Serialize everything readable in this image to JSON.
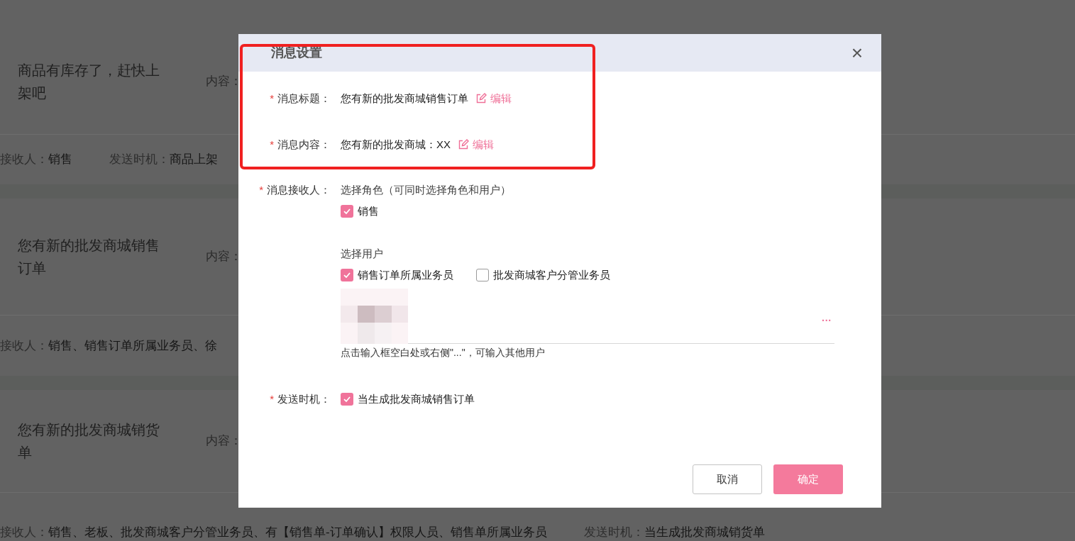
{
  "background": {
    "rows": [
      {
        "title": "商品有库存了，赶快上架吧",
        "content_label": "内容：",
        "receiver_label": "接收人：",
        "receiver_value": "销售",
        "timing_label": "发送时机：",
        "timing_value": "商品上架"
      },
      {
        "title": "您有新的批发商城销售订单",
        "content_label": "内容：",
        "receiver_label": "接收人：",
        "receiver_value": "销售、销售订单所属业务员、徐"
      },
      {
        "title": "您有新的批发商城销货单",
        "content_label": "内容：",
        "receiver_label": "接收人：",
        "receiver_value": "销售、老板、批发商城客户分管业务员、有【销售单-订单确认】权限人员、销售单所属业务员",
        "timing_label": "发送时机：",
        "timing_value": "当生成批发商城销货单"
      }
    ]
  },
  "dialog": {
    "title": "消息设置",
    "close": "×",
    "fields": [
      {
        "kind": "text",
        "label": "消息标题：",
        "required_mark": "*",
        "value": "您有新的批发商城销售订单",
        "edit_label": "编辑"
      },
      {
        "kind": "text",
        "label": "消息内容：",
        "required_mark": "*",
        "value": "您有新的批发商城：XX",
        "edit_label": "编辑"
      },
      {
        "kind": "recipients",
        "label": "消息接收人：",
        "required_mark": "*",
        "role_heading": "选择角色（可同时选择角色和用户）",
        "roles": [
          {
            "label": "销售",
            "checked": true
          }
        ],
        "user_heading": "选择用户",
        "users": [
          {
            "label": "销售订单所属业务员",
            "checked": true
          },
          {
            "label": "批发商城客户分管业务员",
            "checked": false
          }
        ],
        "more": "···",
        "hint": "点击输入框空白处或右侧\"...\"，可输入其他用户"
      },
      {
        "kind": "checks",
        "label": "发送时机：",
        "required_mark": "*",
        "options": [
          {
            "label": "当生成批发商城销售订单",
            "checked": true
          }
        ]
      }
    ],
    "buttons": [
      {
        "label": "取消",
        "kind": "secondary"
      },
      {
        "label": "确定",
        "kind": "primary"
      }
    ]
  }
}
